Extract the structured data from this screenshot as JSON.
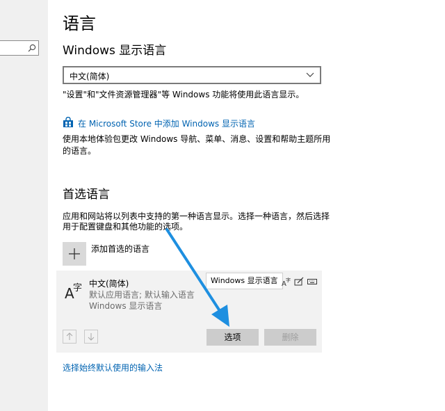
{
  "sidebar": {
    "search": {
      "icon": "search-icon"
    }
  },
  "page": {
    "title": "语言"
  },
  "display_language": {
    "heading": "Windows 显示语言",
    "selected": "中文(简体)",
    "description": "\"设置\"和\"文件资源管理器\"等 Windows 功能将使用此语言显示。",
    "store_link": "在 Microsoft Store 中添加 Windows 显示语言",
    "store_description_line1": "使用本地体验包更改 Windows 导航、菜单、消息、设置和帮助主题所用",
    "store_description_line2": "的语言。"
  },
  "preferred": {
    "heading": "首选语言",
    "description_line1": "应用和网站将以列表中支持的第一种语言显示。选择一种语言，然后选择",
    "description_line2": "用于配置键盘和其他功能的选项。",
    "add_label": "添加首选的语言",
    "languages": [
      {
        "name": "中文(简体)",
        "sub1": "默认应用语言; 默认输入语言",
        "sub2": "Windows 显示语言",
        "tooltip": "Windows 显示语言",
        "icons": [
          "display-language-icon",
          "handwriting-icon",
          "keyboard-icon"
        ]
      }
    ],
    "options_button": "选项",
    "remove_button": "删除"
  },
  "bottom_link": "选择始终默认使用的输入法",
  "colors": {
    "accent": "#0063b1",
    "annotation_arrow": "#1e8fe0",
    "sidebar": "#f0f0f0",
    "card": "#f2f2f2"
  }
}
